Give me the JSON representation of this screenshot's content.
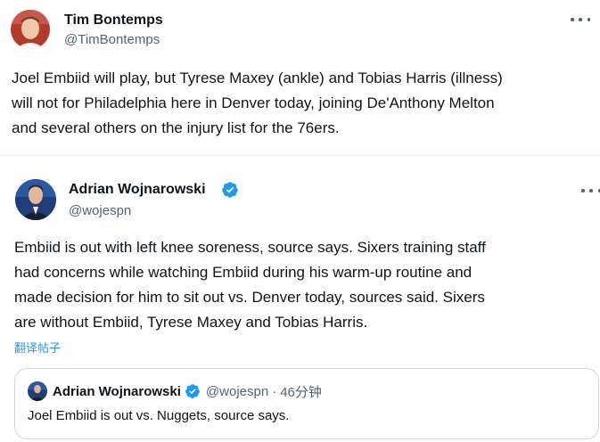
{
  "tweet1": {
    "name": "Tim Bontemps",
    "handle": "@TimBontemps",
    "lines": [
      "Joel Embiid will play, but Tyrese Maxey (ankle) and Tobias Harris (illness)",
      "will not for Philadelphia here in Denver today, joining De'Anthony Melton",
      "and several others on the injury list for the 76ers."
    ]
  },
  "tweet2": {
    "name": "Adrian Wojnarowski",
    "handle": "@wojespn",
    "verified": true,
    "lines": [
      "Embiid is out with left knee soreness, source says. Sixers training staff",
      "had concerns while watching Embiid during his warm-up routine and",
      "made decision for him to sit out vs. Denver today, sources said. Sixers",
      "are without Embiid, Tyrese Maxey and Tobias Harris."
    ],
    "translate_label": "翻译帖子"
  },
  "quote": {
    "name": "Adrian Wojnarowski",
    "handle": "@wojespn",
    "separator": "·",
    "time": "46分钟",
    "text": "Joel Embiid is out vs. Nuggets, source says."
  },
  "colors": {
    "verified": "#1d9bf0",
    "link": "#1d9bf0",
    "secondary_text": "#536471",
    "border": "#cfd9de"
  },
  "icons": [
    "more-options-icon",
    "verified-badge-icon"
  ]
}
